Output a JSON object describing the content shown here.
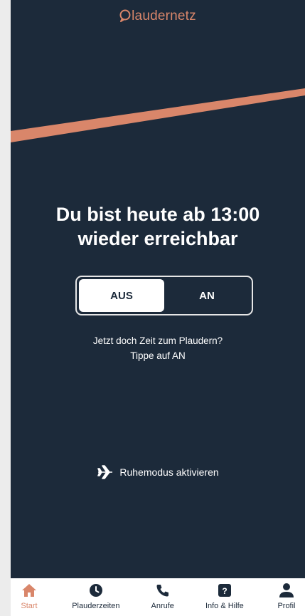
{
  "app": {
    "logo_text": "laudernetz",
    "accent_color": "#d9866a",
    "background_color": "#1c2a3a"
  },
  "main": {
    "headline": "Du bist heute ab 13:00\nwieder erreichbar",
    "toggle": {
      "off_label": "AUS",
      "on_label": "AN",
      "selected": "AUS"
    },
    "hint_line1": "Jetzt doch Zeit zum Plaudern?",
    "hint_line2": "Tippe auf AN",
    "quiet_mode": {
      "label": "Ruhemodus aktivieren",
      "icon": "airplane-icon"
    }
  },
  "tabbar": {
    "items": [
      {
        "label": "Start",
        "icon": "home-icon",
        "active": true
      },
      {
        "label": "Plauderzeiten",
        "icon": "clock-icon",
        "active": false
      },
      {
        "label": "Anrufe",
        "icon": "phone-icon",
        "active": false
      },
      {
        "label": "Info & Hilfe",
        "icon": "help-icon",
        "active": false
      },
      {
        "label": "Profil",
        "icon": "person-icon",
        "active": false
      }
    ]
  }
}
